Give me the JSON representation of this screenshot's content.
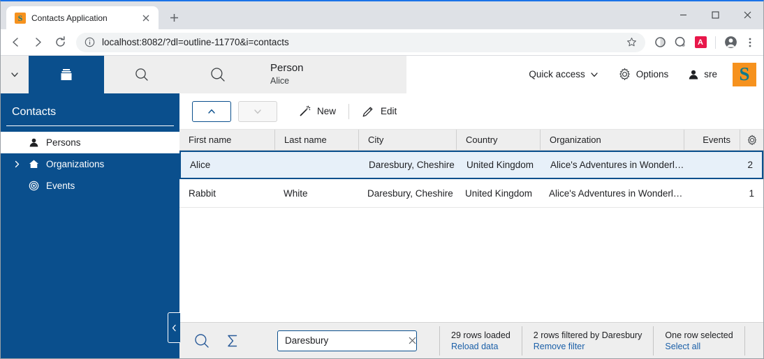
{
  "browser": {
    "tab": {
      "title": "Contacts Application",
      "favicon_letter": "S",
      "close_icon": "close-icon"
    },
    "new_tab_label": "+",
    "window_controls": {
      "minimize": "—",
      "maximize": "□",
      "close": "✕"
    },
    "nav": {
      "back_icon": "back-arrow-icon",
      "forward_icon": "forward-arrow-icon",
      "reload_icon": "reload-icon"
    },
    "omnibox": {
      "info_icon": "site-info-icon",
      "url_scheme": "localhost:8082",
      "url_path": "/?dl=outline-11770&i=contacts",
      "full_url": "localhost:8082/?dl=outline-11770&i=contacts",
      "star_icon": "bookmark-star-icon"
    },
    "extensions": [
      {
        "name": "extension-icon-1",
        "glyph": "●",
        "color": "#5f6368"
      },
      {
        "name": "extension-icon-2",
        "glyph": "●",
        "color": "#5f6368"
      },
      {
        "name": "extension-icon-3",
        "glyph": "A",
        "color": "#e8174a"
      }
    ],
    "profile_icon": "profile-avatar-icon",
    "menu_icon": "three-dot-menu-icon"
  },
  "app": {
    "sidebar": {
      "collapse_chevron": "chevron-down-icon",
      "tabs": [
        {
          "name": "archive-tab",
          "icon": "archive-box-icon",
          "active": true
        },
        {
          "name": "search-tab",
          "icon": "search-icon",
          "active": false
        }
      ],
      "title": "Contacts",
      "items": [
        {
          "label": "Persons",
          "icon": "person-icon",
          "selected": true,
          "expandable": false
        },
        {
          "label": "Organizations",
          "icon": "home-icon",
          "selected": false,
          "expandable": true
        },
        {
          "label": "Events",
          "icon": "target-icon",
          "selected": false,
          "expandable": false
        }
      ],
      "collapse_handle_icon": "chevron-left-icon"
    },
    "header": {
      "search_icon": "search-icon",
      "entity_type": "Person",
      "entity_name": "Alice",
      "quick_access_label": "Quick access",
      "quick_access_icon": "chevron-down-icon",
      "options_label": "Options",
      "options_icon": "gear-icon",
      "user_label": "sre",
      "user_icon": "person-icon",
      "logo_letter": "S"
    },
    "toolbar": {
      "up_button": {
        "name": "navigate-up-button",
        "icon": "chevron-up-icon",
        "enabled": true
      },
      "down_button": {
        "name": "navigate-down-button",
        "icon": "chevron-down-icon",
        "enabled": false
      },
      "new_label": "New",
      "new_icon": "magic-wand-icon",
      "edit_label": "Edit",
      "edit_icon": "pencil-icon"
    },
    "grid": {
      "columns": [
        {
          "key": "first",
          "label": "First name",
          "align": "left"
        },
        {
          "key": "last",
          "label": "Last name",
          "align": "left"
        },
        {
          "key": "city",
          "label": "City",
          "align": "left"
        },
        {
          "key": "country",
          "label": "Country",
          "align": "left"
        },
        {
          "key": "organization",
          "label": "Organization",
          "align": "left"
        },
        {
          "key": "events",
          "label": "Events",
          "align": "right"
        }
      ],
      "settings_icon": "gear-icon",
      "rows": [
        {
          "first": "Alice",
          "last": "",
          "city": "Daresbury, Cheshire",
          "country": "United Kingdom",
          "organization": "Alice's Adventures in Wonderl…",
          "events": "2",
          "selected": true
        },
        {
          "first": "Rabbit",
          "last": "White",
          "city": "Daresbury, Cheshire",
          "country": "United Kingdom",
          "organization": "Alice's Adventures in Wonderl…",
          "events": "1",
          "selected": false
        }
      ]
    },
    "statusbar": {
      "search_icon": "search-icon",
      "sum_icon": "sigma-sum-icon",
      "filter_input_value": "Daresbury",
      "filter_input_placeholder": "",
      "filter_clear_icon": "clear-x-icon",
      "groups": [
        {
          "text": "29 rows loaded",
          "link": "Reload data"
        },
        {
          "text": "2 rows filtered by Daresbury",
          "link": "Remove filter"
        },
        {
          "text": "One row selected",
          "link": "Select all"
        }
      ]
    }
  },
  "colors": {
    "brand_blue": "#0a4f8d",
    "brand_orange": "#f6921e",
    "brand_teal": "#0f7a8a",
    "link_blue": "#1a5fa8",
    "selected_row_bg": "#e7f0f9",
    "chrome_tabstrip": "#dee1e6",
    "panel_gray": "#eeeeee"
  }
}
